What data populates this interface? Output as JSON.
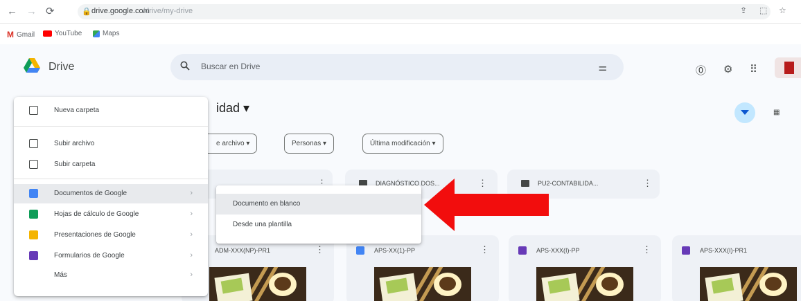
{
  "browser": {
    "url_host": "drive.google.com",
    "url_path": "/drive/my-drive",
    "bookmarks": [
      {
        "label": "Gmail",
        "icon": "gmail-icon"
      },
      {
        "label": "YouTube",
        "icon": "youtube-icon"
      },
      {
        "label": "Maps",
        "icon": "maps-icon"
      }
    ]
  },
  "header": {
    "app_name": "Drive",
    "search_placeholder": "Buscar en Drive"
  },
  "main": {
    "title": "idad ▾",
    "filters": [
      "e archivo ▾",
      "Personas ▾",
      "Última modificación ▾"
    ],
    "folders": [
      "DIAGNÓSTICO DOS...",
      "PU2-CONTABILIDA..."
    ],
    "files": [
      "ADM-XXX(NP)-PR1",
      "APS-XX(1)-PP",
      "APS-XXX(I)-PP",
      "APS-XXX(I)-PR1"
    ]
  },
  "menu": {
    "new_folder": "Nueva carpeta",
    "upload_file": "Subir archivo",
    "upload_folder": "Subir carpeta",
    "google_docs": "Documentos de Google",
    "google_sheets": "Hojas de cálculo de Google",
    "google_slides": "Presentaciones de Google",
    "google_forms": "Formularios de Google",
    "more": "Más"
  },
  "submenu": {
    "blank_document": "Documento en blanco",
    "from_template": "Desde una plantilla"
  },
  "colors": {
    "annotation_arrow": "#f20d0d",
    "drive_blue": "#4285f4",
    "drive_green": "#0f9d58",
    "drive_yellow": "#f4b400"
  }
}
